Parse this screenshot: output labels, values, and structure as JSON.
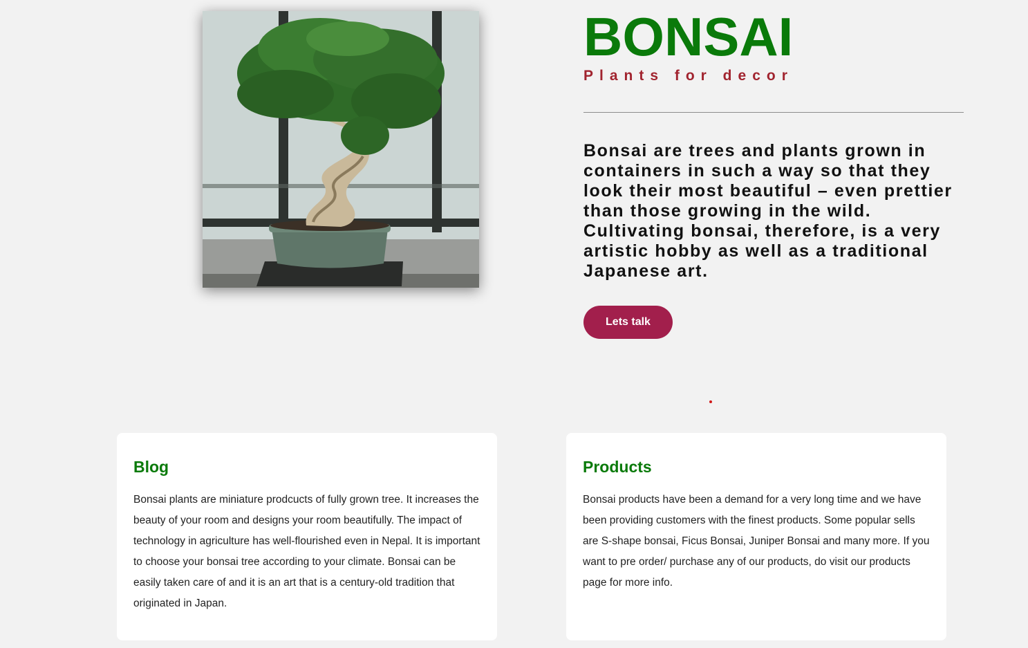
{
  "hero": {
    "image_alt": "bonsai tree in pot",
    "title": "BONSAI",
    "subtitle": "Plants for decor",
    "description": "Bonsai are trees and plants grown in containers in such a way so that they look their most beautiful – even prettier than those growing in the wild. Cultivating bonsai, therefore, is a very artistic hobby as well as a traditional Japanese art.",
    "cta_label": "Lets talk"
  },
  "colors": {
    "title": "#0a7a0a",
    "subtitle": "#a1242f",
    "button": "#a21f4c",
    "background": "#f2f2f2"
  },
  "cards": {
    "blog": {
      "title": "Blog",
      "body": "Bonsai plants are miniature prodcucts of fully grown tree. It increases the beauty of your room and designs your room beautifully. The impact of technology in agriculture has well-flourished even in Nepal. It is important to choose your bonsai tree according to your climate. Bonsai can be easily taken care of and it is an art that is a century-old tradition that originated in Japan."
    },
    "products": {
      "title": "Products",
      "body": "Bonsai products have been a demand for a very long time and we have been providing customers with the finest products. Some popular sells are S-shape bonsai, Ficus Bonsai, Juniper Bonsai and many more. If you want to pre order/ purchase any of our products, do visit our products page for more info."
    }
  }
}
